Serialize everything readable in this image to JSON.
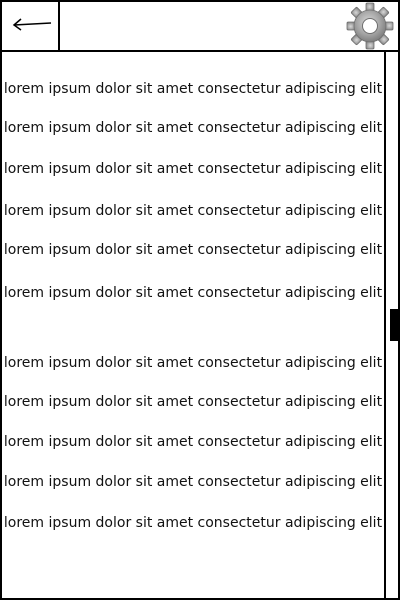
{
  "header": {
    "back_icon": "left-arrow-icon",
    "settings_icon": "gear-icon"
  },
  "content": {
    "lines": [
      "lorem ipsum dolor sit amet consectetur adipiscing elit",
      "lorem ipsum dolor sit amet consectetur adipiscing elit",
      "lorem ipsum dolor sit amet consectetur adipiscing elit",
      "lorem ipsum dolor sit amet consectetur adipiscing elit",
      "lorem ipsum dolor sit amet consectetur adipiscing elit",
      "lorem ipsum dolor sit amet consectetur adipiscing elit",
      "lorem ipsum dolor sit amet consectetur adipiscing elit",
      "lorem ipsum dolor sit amet consectetur adipiscing elit",
      "lorem ipsum dolor sit amet consectetur adipiscing elit",
      "lorem ipsum dolor sit amet consectetur adipiscing elit",
      "lorem ipsum dolor sit amet consectetur adipiscing elit"
    ]
  },
  "scrollbar": {
    "position_fraction": 0.5
  },
  "colors": {
    "border": "#000000",
    "background": "#ffffff",
    "gear": "#9a9a9a"
  }
}
